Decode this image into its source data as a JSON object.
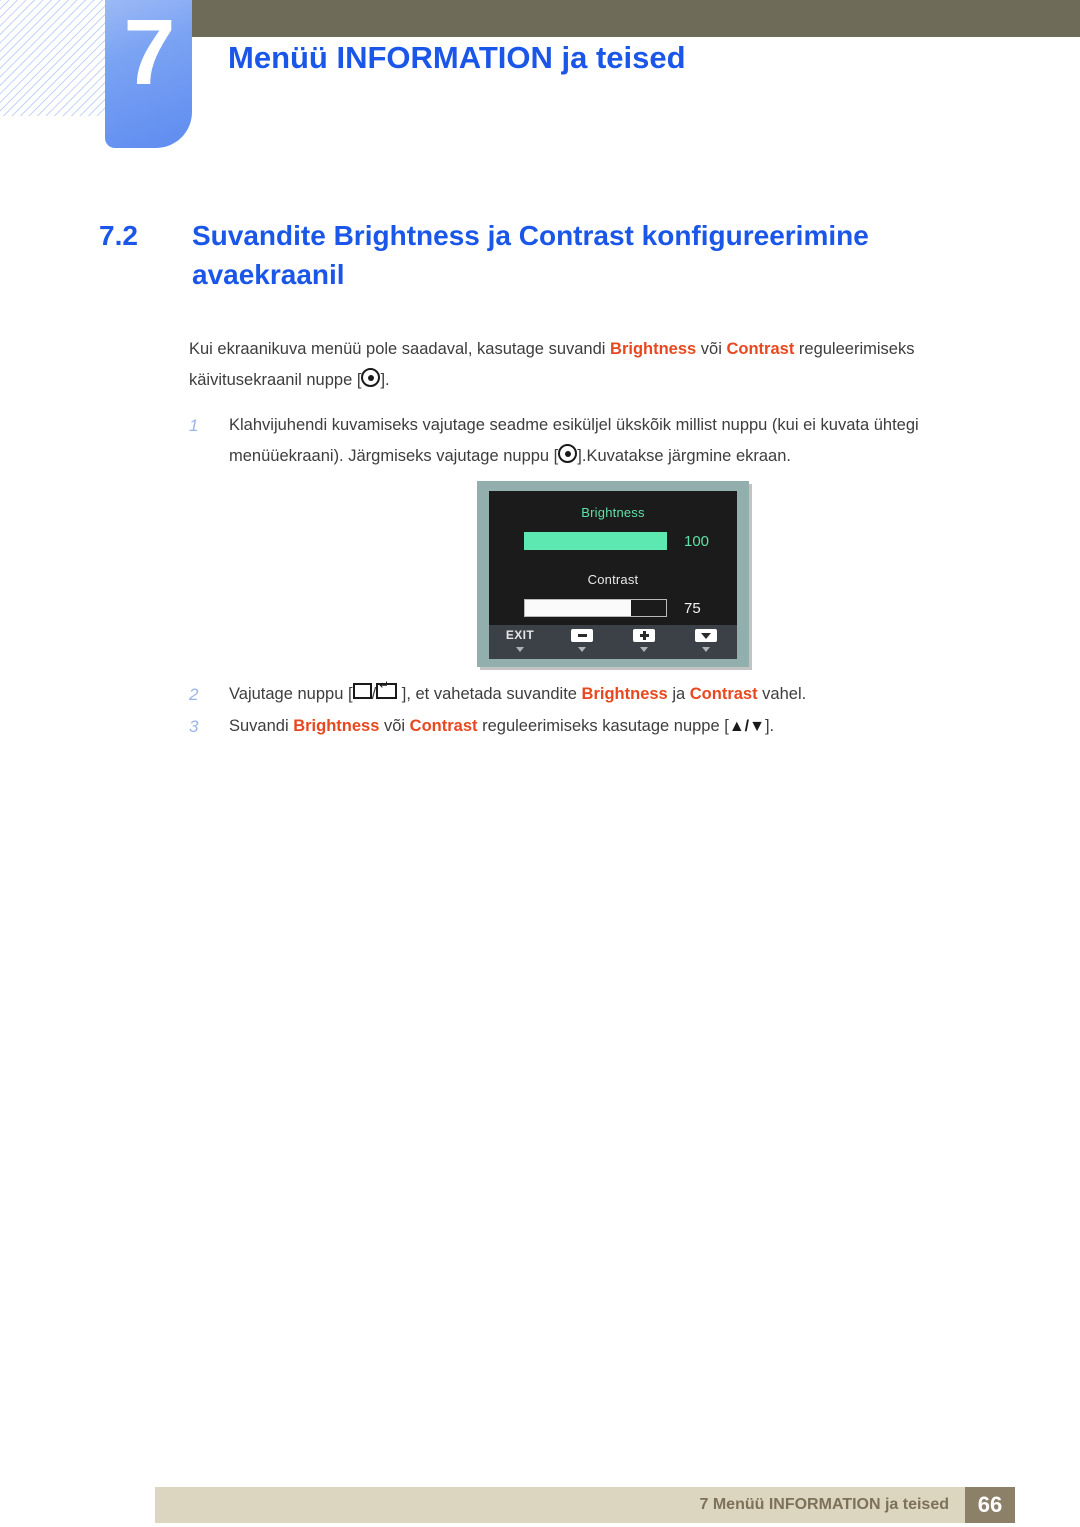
{
  "header": {
    "chapter_number": "7",
    "chapter_title": "Menüü INFORMATION ja teised"
  },
  "section": {
    "number": "7.2",
    "title": "Suvandite Brightness ja Contrast konfigureerimine avaekraanil"
  },
  "intro": {
    "part1": "Kui ekraanikuva menüü pole saadaval, kasutage suvandi ",
    "highlight1": "Brightness",
    "part2": " või ",
    "highlight2": "Contrast",
    "part3": " reguleerimiseks käivitusekraanil nuppe [",
    "part4": "]."
  },
  "steps": [
    {
      "number": "1",
      "part1": "Klahvijuhendi kuvamiseks vajutage seadme esiküljel ükskõik millist nuppu (kui ei kuvata ühtegi menüüekraani). Järgmiseks vajutage nuppu [",
      "part2": "].Kuvatakse järgmine ekraan."
    },
    {
      "number": "2",
      "part1": "Vajutage nuppu [",
      "separator": "/",
      "part2": " ],  et vahetada suvandite ",
      "highlight1": "Brightness",
      "part3": " ja ",
      "highlight2": "Contrast",
      "part4": " vahel."
    },
    {
      "number": "3",
      "part1": "Suvandi ",
      "highlight1": "Brightness",
      "part2": " või ",
      "highlight2": "Contrast",
      "part3": " reguleerimiseks kasutage nuppe [",
      "up_arrow": "▲",
      "separator": "/",
      "down_arrow": "▼",
      "part4": "]."
    }
  ],
  "osd": {
    "brightness_label": "Brightness",
    "brightness_value": "100",
    "contrast_label": "Contrast",
    "contrast_value": "75",
    "exit_label": "EXIT",
    "colors": {
      "frame": "#93afad",
      "screen": "#1b1b1b",
      "green": "#5ce8b0",
      "bottom_bar": "#3b4146"
    }
  },
  "footer": {
    "text": "7 Menüü INFORMATION ja teised",
    "page": "66"
  },
  "theme": {
    "heading_blue": "#1a56e8",
    "highlight_orange": "#e8481f",
    "header_bar": "#6e6b58",
    "footer_band": "#dcd5c0",
    "footer_page_box": "#8d8069"
  }
}
